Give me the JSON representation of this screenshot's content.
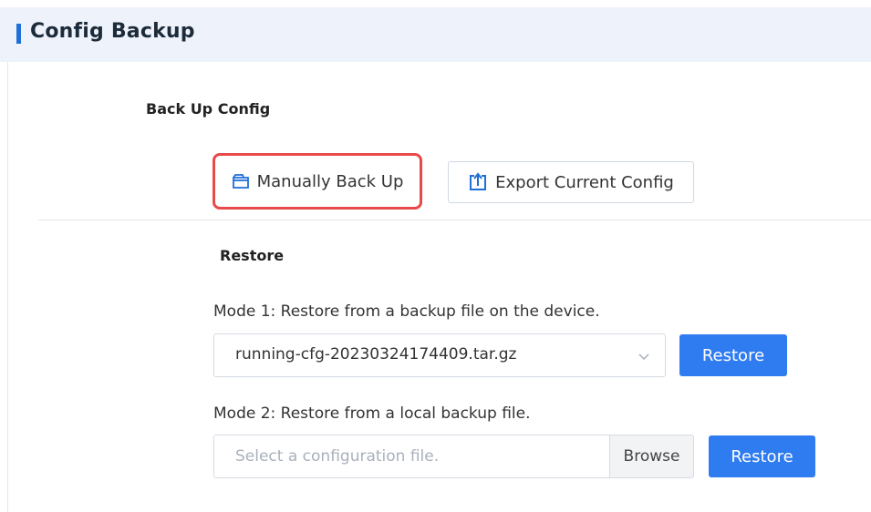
{
  "header": {
    "title": "Config Backup"
  },
  "backup": {
    "section_title": "Back Up Config",
    "manual_label": "Manually Back Up",
    "export_label": "Export Current Config"
  },
  "restore": {
    "section_title": "Restore",
    "mode1_label": "Mode 1: Restore from a backup file on the device.",
    "mode1_selected": "running-cfg-20230324174409.tar.gz",
    "mode1_button": "Restore",
    "mode2_label": "Mode 2: Restore from a local backup file.",
    "mode2_placeholder": "Select a configuration file.",
    "browse_label": "Browse",
    "mode2_button": "Restore"
  },
  "icons": {
    "manual": "folder-icon",
    "export": "export-icon",
    "dropdown": "chevron-down-icon"
  },
  "colors": {
    "accent": "#1f6fd6",
    "primary_button": "#2f7bf0",
    "highlight": "#e84a4a"
  }
}
